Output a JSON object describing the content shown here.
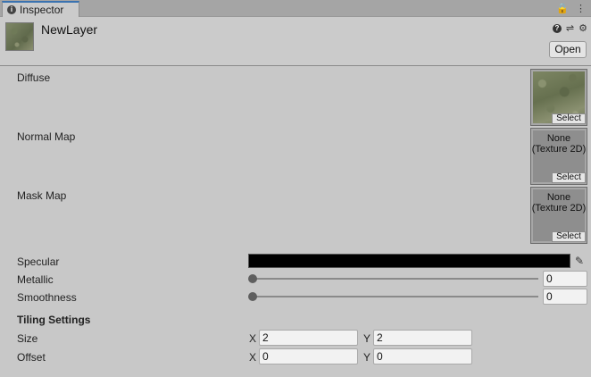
{
  "tab": {
    "title": "Inspector"
  },
  "tabbar": {
    "lock_icon": "lock-icon",
    "menu_icon": "kebab-menu-icon",
    "lock_glyph": "🔒",
    "menu_glyph": "⋮"
  },
  "header": {
    "layer_name": "NewLayer",
    "open_label": "Open",
    "icons": {
      "help": "?",
      "preset": "⇌",
      "settings": "⚙"
    }
  },
  "properties": {
    "diffuse": {
      "label": "Diffuse",
      "select": "Select"
    },
    "normal_map": {
      "label": "Normal Map",
      "value_line1": "None",
      "value_line2": "(Texture 2D)",
      "select": "Select"
    },
    "mask_map": {
      "label": "Mask Map",
      "value_line1": "None",
      "value_line2": "(Texture 2D)",
      "select": "Select"
    },
    "specular": {
      "label": "Specular",
      "color": "#000000",
      "picker_glyph": "✎"
    },
    "metallic": {
      "label": "Metallic",
      "value": "0",
      "fraction": 0
    },
    "smoothness": {
      "label": "Smoothness",
      "value": "0",
      "fraction": 0
    }
  },
  "tiling": {
    "title": "Tiling Settings",
    "size": {
      "label": "Size",
      "x_label": "X",
      "x": "2",
      "y_label": "Y",
      "y": "2"
    },
    "offset": {
      "label": "Offset",
      "x_label": "X",
      "x": "0",
      "y_label": "Y",
      "y": "0"
    }
  }
}
